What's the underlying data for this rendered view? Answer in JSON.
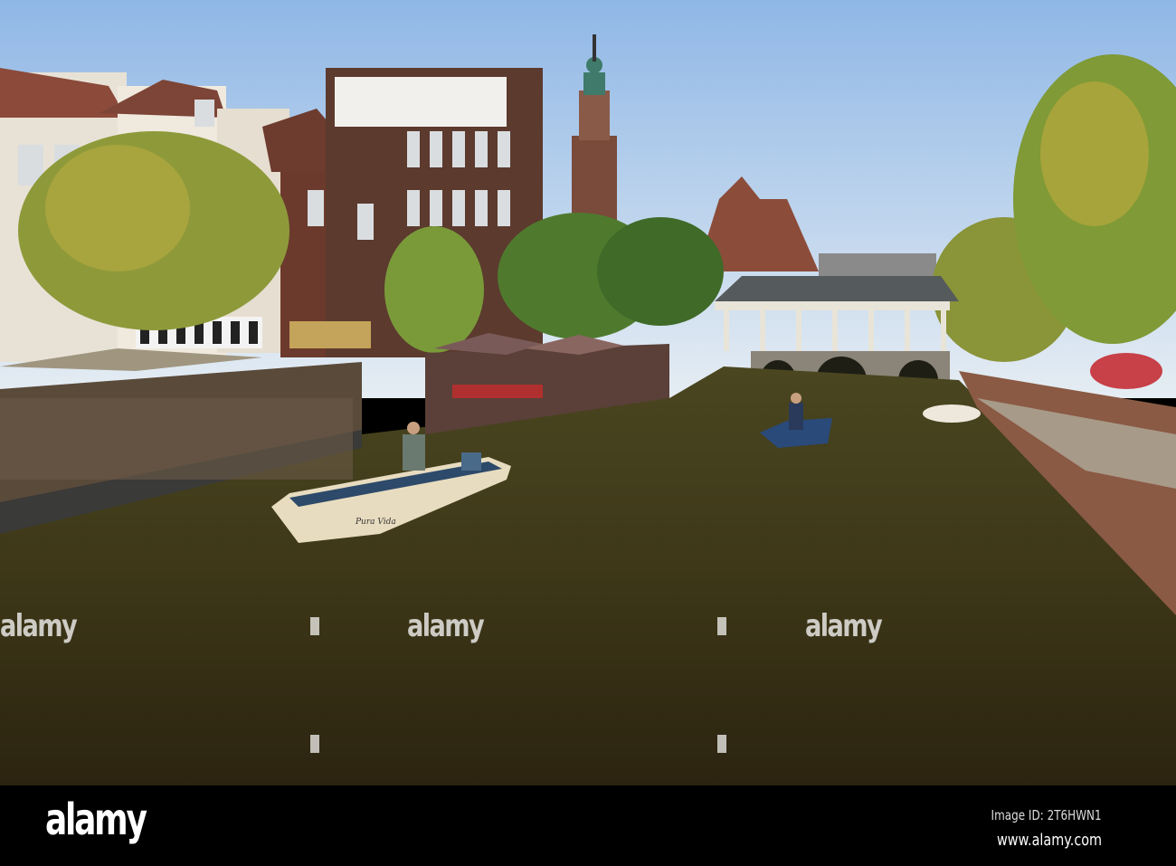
{
  "photo": {
    "subject": "canal-scene",
    "boat_name": "Pura Vida",
    "watermark_text": "alamy"
  },
  "footer": {
    "logo": "alamy",
    "image_id": "Image ID: 2T6HWN1",
    "website": "www.alamy.com"
  },
  "colors": {
    "sky": "#b8d3ee",
    "water": "#3b3518",
    "footer": "#000000"
  }
}
